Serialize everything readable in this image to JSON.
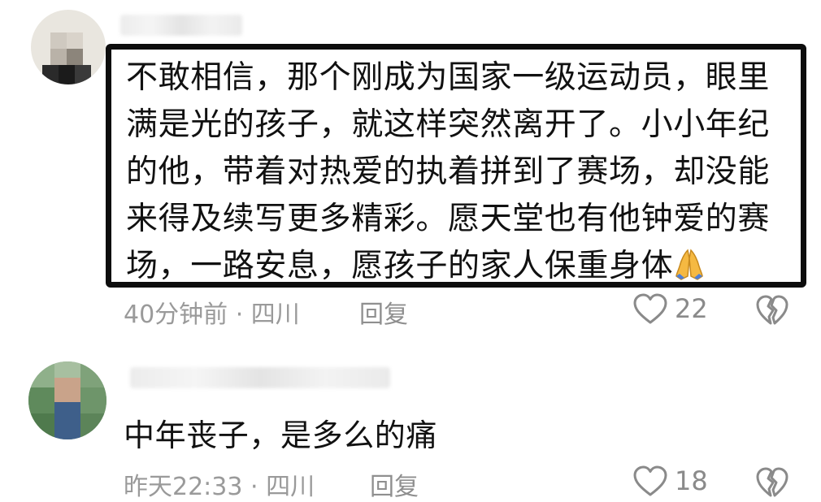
{
  "comments": [
    {
      "text": "不敢相信，那个刚成为国家一级运动员，眼里满是光的孩子，就这样突然离开了。小小年纪的他，带着对热爱的执着拼到了赛场，却没能来得及续写更多精彩。愿天堂也有他钟爱的赛场，一路安息，愿孩子的家人保重身体",
      "emoji": "praying-hands-icon",
      "time_location": "40分钟前 · 四川",
      "reply_label": "回复",
      "like_count": "22"
    },
    {
      "text": "中年丧子，是多么的痛",
      "time_location": "昨天22:33 · 四川",
      "reply_label": "回复",
      "like_count": "18"
    }
  ],
  "colors": {
    "highlight_border": "#0d0d0d",
    "meta_text": "#9a9a9a",
    "body_text": "#111111",
    "emoji_fill": "#f5b942"
  }
}
